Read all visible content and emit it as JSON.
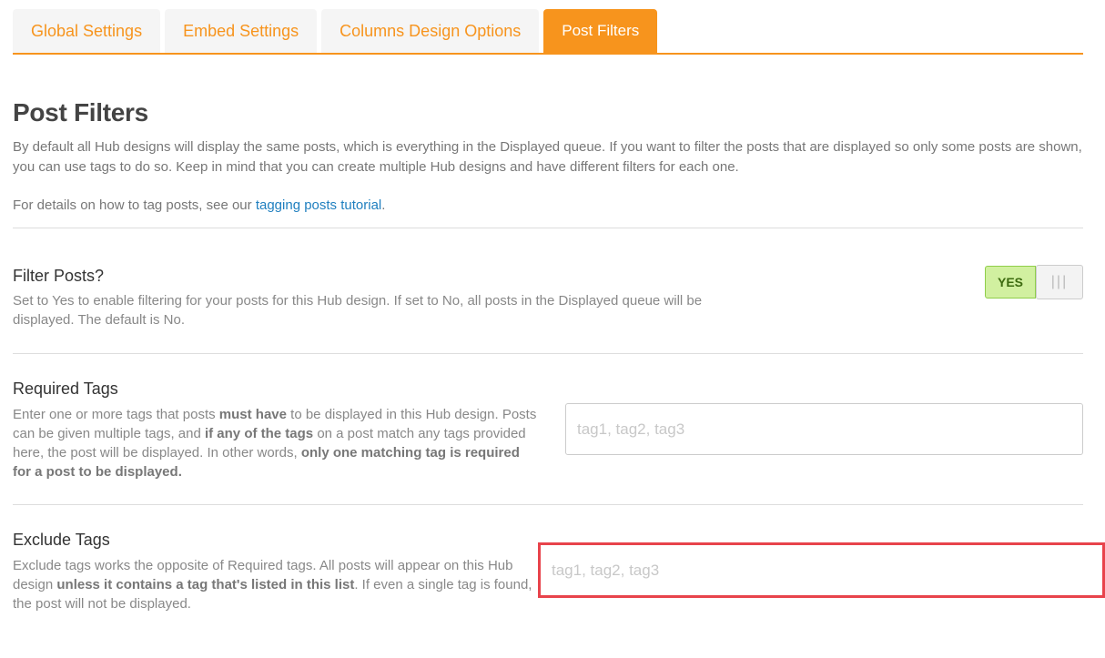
{
  "tabs": [
    {
      "label": "Global Settings",
      "active": false
    },
    {
      "label": "Embed Settings",
      "active": false
    },
    {
      "label": "Columns Design Options",
      "active": false
    },
    {
      "label": "Post Filters",
      "active": true
    }
  ],
  "page": {
    "title": "Post Filters",
    "intro": "By default all Hub designs will display the same posts, which is everything in the Displayed queue. If you want to filter the posts that are displayed so only some posts are shown, you can use tags to do so. Keep in mind that you can create multiple Hub designs and have different filters for each one.",
    "note_prefix": "For details on how to tag posts, see our ",
    "note_link": "tagging posts tutorial",
    "note_suffix": "."
  },
  "filter_posts": {
    "label": "Filter Posts?",
    "description": "Set to Yes to enable filtering for your posts for this Hub design. If set to No, all posts in the Displayed queue will be displayed. The default is No.",
    "toggle_value": "YES",
    "toggle_handle": "|||"
  },
  "required_tags": {
    "label": "Required Tags",
    "desc_1": "Enter one or more tags that posts ",
    "desc_b1": "must have",
    "desc_2": " to be displayed in this Hub design. Posts can be given multiple tags, and ",
    "desc_b2": "if any of the tags",
    "desc_3": " on a post match any tags provided here, the post will be displayed. In other words, ",
    "desc_b3": "only one matching tag is required for a post to be displayed.",
    "placeholder": "tag1, tag2, tag3",
    "value": ""
  },
  "exclude_tags": {
    "label": "Exclude Tags",
    "desc_1": "Exclude tags works the opposite of Required tags. All posts will appear on this Hub design ",
    "desc_b1": "unless it contains a tag that's listed in this list",
    "desc_2": ". If even a single tag is found, the post will not be displayed.",
    "placeholder": "tag1, tag2, tag3",
    "value": ""
  },
  "colors": {
    "accent": "#f7941d",
    "link": "#1f7fbf",
    "toggle_on": "#d1f0a0",
    "highlight": "#e8434b"
  }
}
